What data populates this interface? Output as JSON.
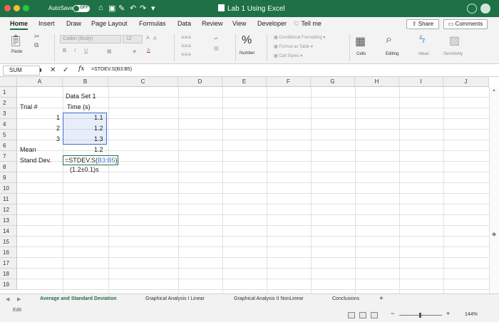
{
  "titlebar": {
    "autosave_label": "AutoSave",
    "autosave_state": "OFF",
    "window_title": "Lab 1 Using Excel",
    "color": "#1e7145"
  },
  "ribbon_tabs": [
    "Home",
    "Insert",
    "Draw",
    "Page Layout",
    "Formulas",
    "Data",
    "Review",
    "View",
    "Developer"
  ],
  "tell_me": "Tell me",
  "share_label": "Share",
  "comments_label": "Comments",
  "ribbon": {
    "paste": "Paste",
    "font_name": "Calibri (Body)",
    "font_size": "12",
    "number_label": "Number",
    "conditional_formatting": "Conditional Formatting",
    "format_as_table": "Format as Table",
    "cell_styles": "Cell Styles",
    "cells": "Cells",
    "editing": "Editing",
    "ideas": "Ideas",
    "sensitivity": "Sensitivity"
  },
  "formula_bar": {
    "name_box": "SUM",
    "fx": "fx",
    "formula": "=STDEV.S(B3:B5)"
  },
  "columns": [
    "A",
    "B",
    "C",
    "D",
    "E",
    "F",
    "G",
    "H",
    "I",
    "J"
  ],
  "rows": [
    "1",
    "2",
    "3",
    "4",
    "5",
    "6",
    "7",
    "8",
    "9",
    "10",
    "11",
    "12",
    "13",
    "14",
    "15",
    "16",
    "17",
    "18",
    "19"
  ],
  "cells": {
    "B1": "Data Set 1",
    "A2": "Trial #",
    "B2": "Time (s)",
    "A3": "1",
    "B3": "1.1",
    "A4": "2",
    "B4": "1.2",
    "A5": "3",
    "B5": "1.3",
    "A6": "Mean",
    "B6": "1.2",
    "A7": "Stand Dev.",
    "B7_prefix": "=STDEV.S(",
    "B7_ref": "B3:B5",
    "B7_suffix": ")",
    "B8": "(1.2±0.1)s"
  },
  "sheets": [
    "Average and Standard Deviation",
    "Graphical Analysis I Linear",
    "Graphical Analysis II NonLinear",
    "Conclusions"
  ],
  "status": {
    "mode": "Edit",
    "zoom": "144%"
  }
}
